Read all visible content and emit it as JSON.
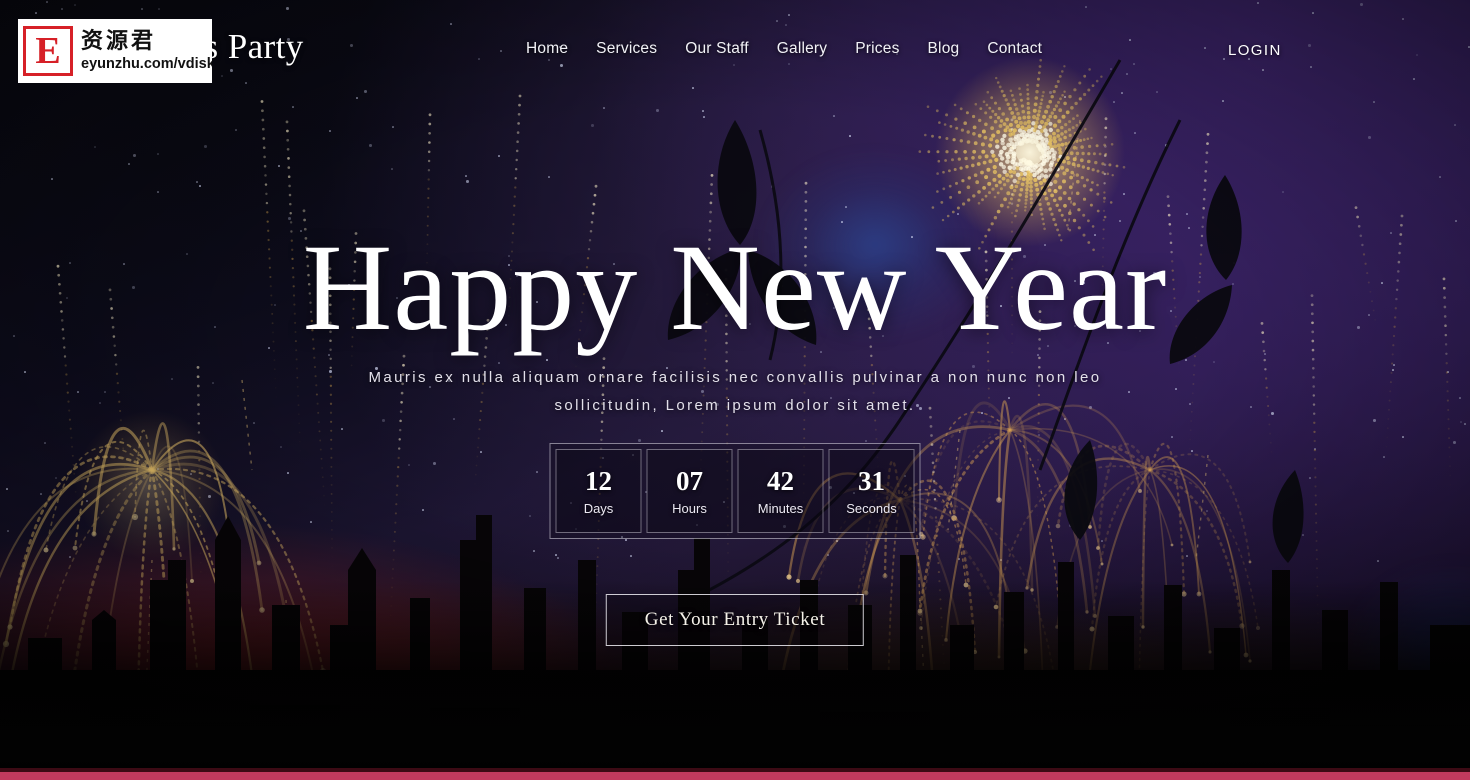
{
  "site": {
    "brand": "Let's Party"
  },
  "watermark": {
    "badge_letter": "E",
    "chinese": "资源君",
    "url": "eyunzhu.com/vdisk"
  },
  "nav": {
    "items": [
      {
        "label": "Home"
      },
      {
        "label": "Services"
      },
      {
        "label": "Our Staff"
      },
      {
        "label": "Gallery"
      },
      {
        "label": "Prices"
      },
      {
        "label": "Blog"
      },
      {
        "label": "Contact"
      }
    ],
    "login_label": "LOGIN"
  },
  "hero": {
    "title": "Happy New Year",
    "subtitle": "Mauris ex nulla aliquam ornare facilisis nec convallis pulvinar a non nunc non leo sollicitudin, Lorem ipsum dolor sit amet.",
    "cta_label": "Get Your Entry Ticket"
  },
  "countdown": {
    "units": [
      {
        "value": "12",
        "label": "Days"
      },
      {
        "value": "07",
        "label": "Hours"
      },
      {
        "value": "42",
        "label": "Minutes"
      },
      {
        "value": "31",
        "label": "Seconds"
      }
    ]
  },
  "colors": {
    "accent_bar": "#c23a5e",
    "text_primary": "#ffffff",
    "sky_top_left": "#07070f",
    "sky_purple": "#2e1b55",
    "glow_red": "#8f1a14",
    "firework_gold": "#f2c14e"
  }
}
